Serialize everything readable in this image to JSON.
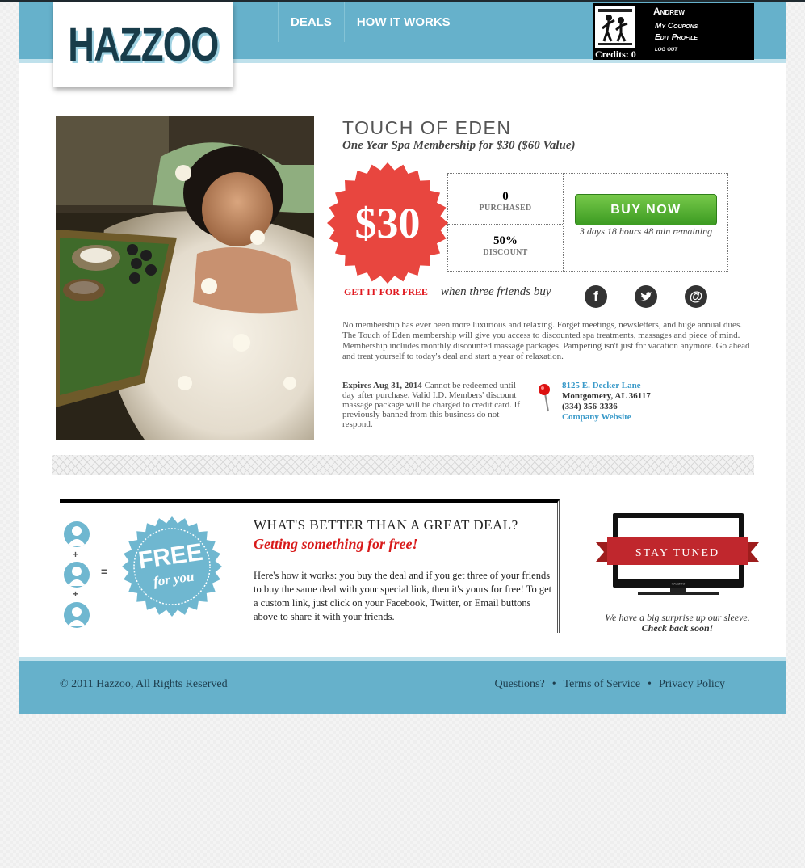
{
  "brand": {
    "logo": "HAZZOO"
  },
  "nav": {
    "items": [
      "DEALS",
      "HOW IT WORKS"
    ]
  },
  "user": {
    "name": "Andrew",
    "credits": "Credits: 0",
    "menu": [
      "My Coupons",
      "Edit Profile",
      "log out"
    ]
  },
  "deal": {
    "title": "TOUCH OF EDEN",
    "subtitle": "One Year Spa Membership for $30 ($60 Value)",
    "price": "$30",
    "purchased_count": "0",
    "purchased_label": "PURCHASED",
    "discount_value": "50%",
    "discount_label": "DISCOUNT",
    "buy_label": "BUY NOW",
    "time_remaining": "3 days 18 hours 48 min remaining",
    "free_label": "GET IT FOR FREE",
    "free_condition": "when three friends buy",
    "description": "No membership has ever been more luxurious and relaxing. Forget meetings, newsletters, and huge annual dues. The Touch of Eden membership will give you access to discounted spa treatments, massages and piece of mind. Membership includes monthly discounted massage packages. Pampering isn't just for vacation anymore. Go ahead and treat yourself to today's deal and start a year of relaxation.",
    "expires_bold": "Expires Aug 31, 2014",
    "expires_text": "Cannot be redeemed until day after purchase. Valid I.D. Members' discount massage package will be charged to credit card. If previously banned from this business do not respond.",
    "address": {
      "street": "8125 E. Decker Lane",
      "city": "Montgomery, AL 36117",
      "phone": "(334) 356-3336",
      "website": "Company Website"
    }
  },
  "social": [
    {
      "icon": "facebook-icon",
      "glyph": "f"
    },
    {
      "icon": "twitter-icon",
      "glyph": "t"
    },
    {
      "icon": "email-icon",
      "glyph": "@"
    }
  ],
  "free_section": {
    "badge_line1": "FREE",
    "badge_line2": "for you",
    "plus": "+",
    "equals": "=",
    "title": "WHAT'S BETTER THAN A GREAT DEAL?",
    "highlight": "Getting something for free!",
    "body": "Here's how it works: you buy the deal and if you get three of your friends to buy the same deal with your special link, then it's yours for free! To get a custom link, just click on your Facebook, Twitter, or Email buttons above to share it with your friends."
  },
  "stay_tuned": {
    "banner": "STAY TUNED",
    "tv_brand": "HAZZOO",
    "line1": "We have a big surprise up our sleeve.",
    "line2": "Check back soon!"
  },
  "footer": {
    "copyright": "© 2011 Hazzoo, All Rights Reserved",
    "links": [
      "Questions?",
      "Terms of Service",
      "Privacy Policy"
    ],
    "separator": "•"
  },
  "colors": {
    "header_blue": "#66b1cb",
    "price_red": "#e8463f",
    "buy_green": "#4caf2e",
    "free_red": "#d81a1a"
  }
}
